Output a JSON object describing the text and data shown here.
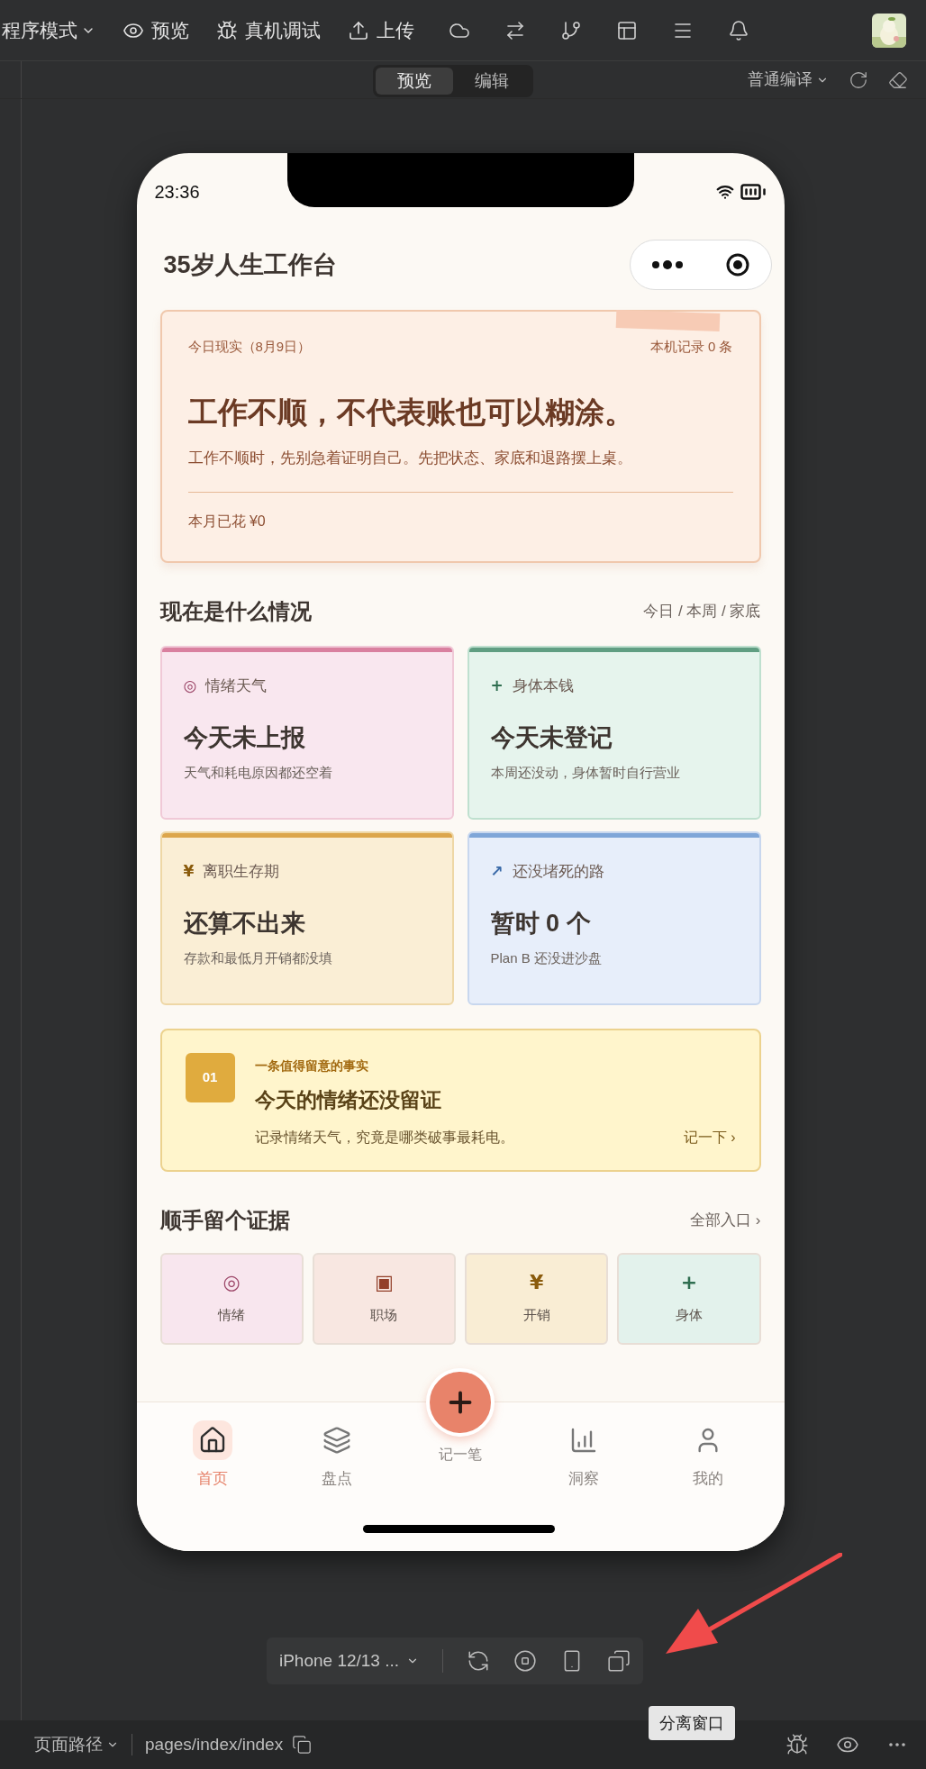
{
  "toolbar": {
    "mode": "程序模式",
    "actions": [
      {
        "kind": "eye",
        "label": "预览"
      },
      {
        "kind": "bug",
        "label": "真机调试"
      },
      {
        "kind": "upload",
        "label": "上传"
      }
    ]
  },
  "view_switch": [
    {
      "label": "预览",
      "selected": true
    },
    {
      "label": "编辑",
      "selected": false
    }
  ],
  "compile_mode": "普通编译",
  "phone": {
    "status_time": "23:36",
    "title": "35岁人生工作台",
    "hero": {
      "date": "今日现实（8月9日）",
      "records": "本机记录 0 条",
      "headline": "工作不顺，不代表账也可以糊涂。",
      "subline": "工作不顺时，先别急着证明自己。先把状态、家底和退路摆上桌。",
      "spent": "本月已花 ¥0"
    },
    "status_section": {
      "title": "现在是什么情况",
      "scope": "今日 / 本周 / 家底"
    },
    "status_cards": [
      {
        "icon": "◎",
        "label": "情绪天气",
        "value": "今天未上报",
        "note": "天气和耗电原因都还空着",
        "color": "#d9809f"
      },
      {
        "icon": "+",
        "label": "身体本钱",
        "value": "今天未登记",
        "note": "本周还没动，身体暂时自行营业",
        "color": "#609e82"
      },
      {
        "icon": "¥",
        "label": "离职生存期",
        "value": "还算不出来",
        "note": "存款和最低月开销都没填",
        "color": "#dca64c"
      },
      {
        "icon": "↗",
        "label": "还没堵死的路",
        "value": "暂时 0 个",
        "note": "Plan B 还没进沙盘",
        "color": "#7fa6d8"
      }
    ],
    "fact": {
      "number": "01",
      "eyebrow": "一条值得留意的事实",
      "title": "今天的情绪还没留证",
      "text": "记录情绪天气，究竟是哪类破事最耗电。",
      "link": "记一下 ›"
    },
    "evidence_section": {
      "title": "顺手留个证据",
      "link": "全部入口 ›"
    },
    "evidence": [
      {
        "icon": "◎",
        "label": "情绪",
        "color": "#f8e6ee"
      },
      {
        "icon": "▣",
        "label": "职场",
        "color": "#f8e7e1"
      },
      {
        "icon": "¥",
        "label": "开销",
        "color": "#f9edd4"
      },
      {
        "icon": "+",
        "label": "身体",
        "color": "#e3f2ec"
      }
    ],
    "tabbar": [
      {
        "kind": "home",
        "label": "首页",
        "selected": true
      },
      {
        "kind": "stack",
        "label": "盘点",
        "selected": false
      },
      {
        "kind": "add",
        "label": "记一笔",
        "selected": false
      },
      {
        "kind": "chart",
        "label": "洞察",
        "selected": false
      },
      {
        "kind": "user",
        "label": "我的",
        "selected": false
      }
    ]
  },
  "device_bar": {
    "device": "iPhone 12/13 ..."
  },
  "tooltip": "分离窗口",
  "status_bar": {
    "path_label": "页面路径",
    "path": "pages/index/index"
  }
}
